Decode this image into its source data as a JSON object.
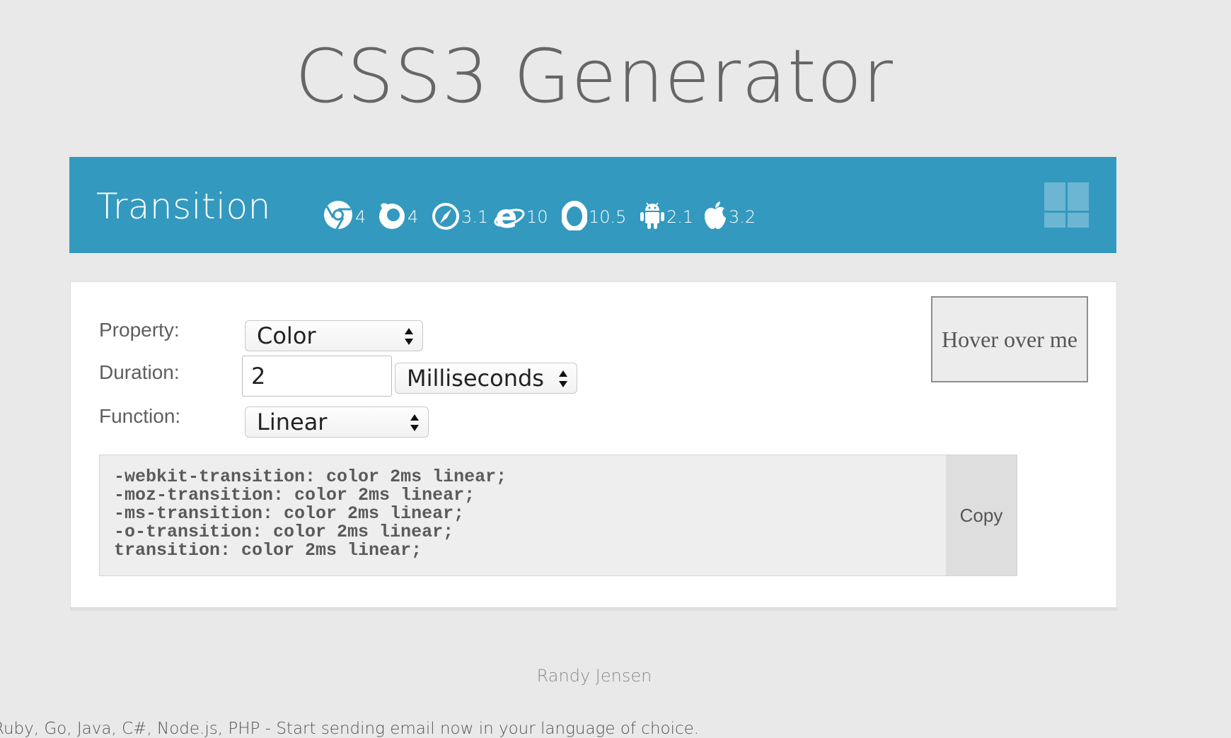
{
  "page": {
    "title": "CSS3 Generator"
  },
  "panel": {
    "title": "Transition",
    "accent_color": "#3399bf",
    "browsers": [
      {
        "icon": "chrome-icon",
        "version": "4"
      },
      {
        "icon": "firefox-icon",
        "version": "4"
      },
      {
        "icon": "safari-icon",
        "version": "3.1"
      },
      {
        "icon": "ie-icon",
        "version": "10"
      },
      {
        "icon": "opera-icon",
        "version": "10.5"
      },
      {
        "icon": "android-icon",
        "version": "2.1"
      },
      {
        "icon": "apple-icon",
        "version": "3.2"
      }
    ],
    "menu_icon": "grid-icon"
  },
  "form": {
    "property": {
      "label": "Property:",
      "value": "Color"
    },
    "duration": {
      "label": "Duration:",
      "value": "2",
      "unit": "Milliseconds"
    },
    "function": {
      "label": "Function:",
      "value": "Linear"
    }
  },
  "preview": {
    "label": "Hover over me"
  },
  "code": {
    "lines": [
      "-webkit-transition: color 2ms linear;",
      "-moz-transition: color 2ms linear;",
      "-ms-transition: color 2ms linear;",
      "-o-transition: color 2ms linear;",
      "transition: color 2ms linear;"
    ],
    "copy_label": "Copy"
  },
  "footer": {
    "author": "Randy Jensen",
    "ad_text": "Ruby, Go, Java, C#, Node.js, PHP - Start sending email now in your language of choice."
  }
}
